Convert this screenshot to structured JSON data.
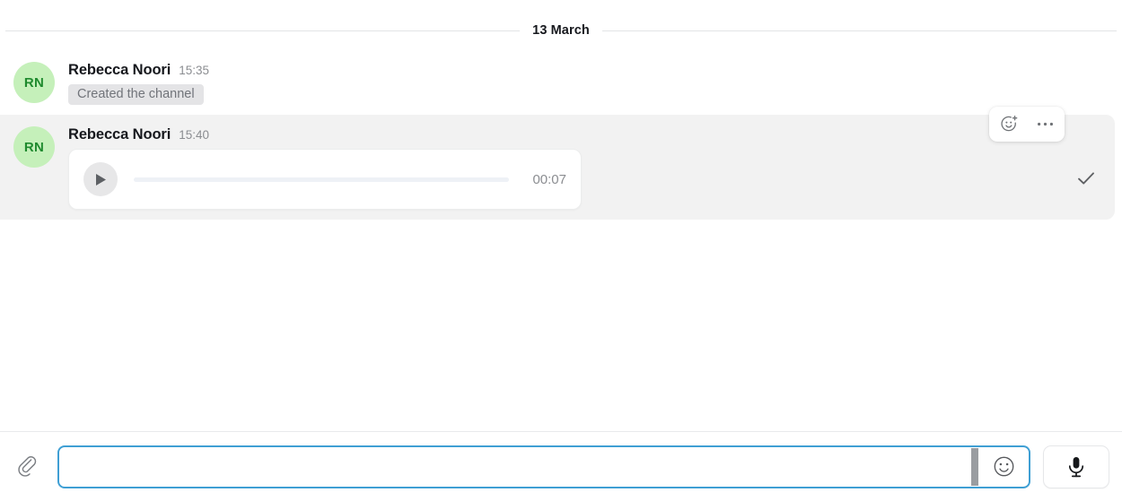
{
  "conversation": {
    "date_divider": {
      "label": "13 March"
    },
    "messages": [
      {
        "avatar_initials": "RN",
        "sender": "Rebecca Noori",
        "time": "15:35",
        "type": "system",
        "system_text": "Created the channel"
      },
      {
        "avatar_initials": "RN",
        "sender": "Rebecca Noori",
        "time": "15:40",
        "type": "voice",
        "voice": {
          "duration": "00:07",
          "progress_percent": 0,
          "play_icon": "play-icon"
        },
        "read_receipt_icon": "check-icon",
        "toolbar": {
          "add_reaction_icon": "add-reaction-icon",
          "more_options_icon": "more-options-icon"
        }
      }
    ]
  },
  "composer": {
    "attach_icon": "paperclip-icon",
    "input": {
      "value": "",
      "placeholder": ""
    },
    "emoji_icon": "emoji-smiley-icon",
    "mic_icon": "microphone-icon"
  },
  "colors": {
    "accent_blue": "#3f9fd4",
    "avatar_bg": "#c5f0ba",
    "avatar_text": "#1f8a2e",
    "row_highlight": "#f2f2f2",
    "badge_bg": "#e4e4e6"
  }
}
